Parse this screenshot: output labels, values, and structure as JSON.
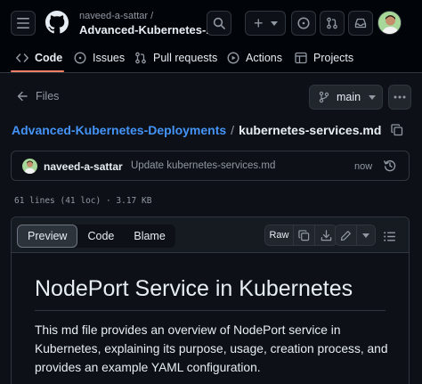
{
  "header": {
    "owner": "naveed-a-sattar /",
    "repo": "Advanced-Kubernetes-...",
    "new_button_label": "+"
  },
  "tabs": [
    {
      "label": "Code",
      "icon": "code-icon",
      "active": true
    },
    {
      "label": "Issues",
      "icon": "issue-icon",
      "active": false
    },
    {
      "label": "Pull requests",
      "icon": "pull-request-icon",
      "active": false
    },
    {
      "label": "Actions",
      "icon": "play-icon",
      "active": false
    },
    {
      "label": "Projects",
      "icon": "table-icon",
      "active": false
    }
  ],
  "files_nav": {
    "label": "Files",
    "branch": "main"
  },
  "breadcrumb": {
    "repo_link": "Advanced-Kubernetes-Deployments",
    "separator": "/",
    "file": "kubernetes-services.md"
  },
  "commit": {
    "author": "naveed-a-sattar",
    "message": "Update kubernetes-services.md",
    "time": "now"
  },
  "file_meta": "61 lines (41 loc) · 3.17 KB",
  "file_header": {
    "views": [
      "Preview",
      "Code",
      "Blame"
    ],
    "selected_view": "Preview",
    "raw_label": "Raw"
  },
  "markdown": {
    "heading": "NodePort Service in Kubernetes",
    "paragraph": "This md file provides an overview of NodePort service in Kubernetes, explaining its purpose, usage, creation process, and provides an example YAML configuration."
  },
  "colors": {
    "background": "#0d1117",
    "header_background": "#010409",
    "link": "#4493f8",
    "tab_underline": "#f78166",
    "muted_text": "#9198a1"
  }
}
